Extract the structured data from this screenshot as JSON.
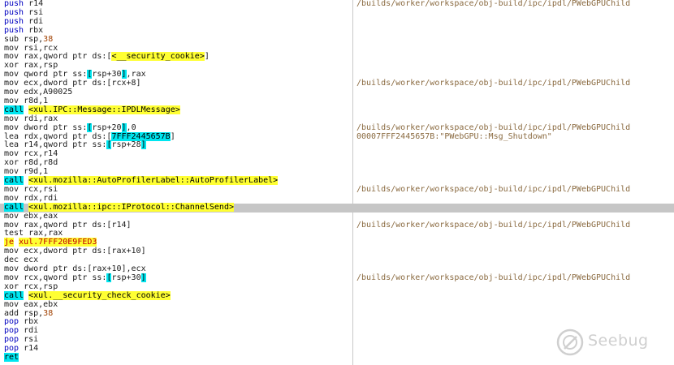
{
  "rows": [
    {
      "mnem": "push",
      "parts": [
        {
          "t": " r14"
        }
      ],
      "comment": "/builds/worker/workspace/obj-build/ipc/ipdl/PWebGPUChild"
    },
    {
      "mnem": "push",
      "parts": [
        {
          "t": " rsi"
        }
      ],
      "comment": ""
    },
    {
      "mnem": "push",
      "parts": [
        {
          "t": " rdi"
        }
      ],
      "comment": ""
    },
    {
      "mnem": "push",
      "parts": [
        {
          "t": " rbx"
        }
      ],
      "comment": ""
    },
    {
      "mnem": "sub",
      "parts": [
        {
          "t": " rsp,"
        },
        {
          "t": "38",
          "c": "num"
        }
      ],
      "comment": ""
    },
    {
      "mnem": "mov",
      "parts": [
        {
          "t": " rsi,rcx"
        }
      ],
      "comment": ""
    },
    {
      "mnem": "mov",
      "parts": [
        {
          "t": " rax,qword ptr ds:["
        },
        {
          "t": "<__security_cookie>",
          "c": "tgt"
        },
        {
          "t": "]"
        }
      ],
      "comment": ""
    },
    {
      "mnem": "xor",
      "parts": [
        {
          "t": " rax,rsp"
        }
      ],
      "comment": ""
    },
    {
      "mnem": "mov",
      "parts": [
        {
          "t": " qword ptr ss:"
        },
        {
          "t": "[",
          "c": "hl"
        },
        {
          "t": "rsp+30"
        },
        {
          "t": "]",
          "c": "hl"
        },
        {
          "t": ",rax"
        }
      ],
      "comment": ""
    },
    {
      "mnem": "mov",
      "parts": [
        {
          "t": " ecx,dword ptr ds:[rcx+8]"
        }
      ],
      "comment": "/builds/worker/workspace/obj-build/ipc/ipdl/PWebGPUChild"
    },
    {
      "mnem": "mov",
      "parts": [
        {
          "t": " edx,A90025"
        }
      ],
      "comment": ""
    },
    {
      "mnem": "mov",
      "parts": [
        {
          "t": " r8d,1"
        }
      ],
      "comment": ""
    },
    {
      "mnem": "call",
      "mc": "mn-call",
      "parts": [
        {
          "t": " "
        },
        {
          "t": "<xul.IPC::Message::IPDLMessage>",
          "c": "tgt"
        }
      ],
      "comment": ""
    },
    {
      "mnem": "mov",
      "parts": [
        {
          "t": " rdi,rax"
        }
      ],
      "comment": ""
    },
    {
      "mnem": "mov",
      "parts": [
        {
          "t": " dword ptr ss:"
        },
        {
          "t": "[",
          "c": "hl"
        },
        {
          "t": "rsp+20"
        },
        {
          "t": "]",
          "c": "hl"
        },
        {
          "t": ",0"
        }
      ],
      "comment": "/builds/worker/workspace/obj-build/ipc/ipdl/PWebGPUChild"
    },
    {
      "mnem": "lea",
      "parts": [
        {
          "t": " rdx,qword ptr ds:["
        },
        {
          "t": "7FFF2445657B",
          "c": "hl"
        },
        {
          "t": "]"
        }
      ],
      "comment": "00007FFF2445657B:\"PWebGPU::Msg_Shutdown\""
    },
    {
      "mnem": "lea",
      "parts": [
        {
          "t": " r14,qword ptr ss:"
        },
        {
          "t": "[",
          "c": "hl"
        },
        {
          "t": "rsp+28"
        },
        {
          "t": "]",
          "c": "hl"
        }
      ],
      "comment": ""
    },
    {
      "mnem": "mov",
      "parts": [
        {
          "t": " rcx,r14"
        }
      ],
      "comment": ""
    },
    {
      "mnem": "xor",
      "parts": [
        {
          "t": " r8d,r8d"
        }
      ],
      "comment": ""
    },
    {
      "mnem": "mov",
      "parts": [
        {
          "t": " r9d,1"
        }
      ],
      "comment": ""
    },
    {
      "mnem": "call",
      "mc": "mn-call",
      "parts": [
        {
          "t": " "
        },
        {
          "t": "<xul.mozilla::AutoProfilerLabel::AutoProfilerLabel>",
          "c": "tgt"
        }
      ],
      "comment": ""
    },
    {
      "mnem": "mov",
      "parts": [
        {
          "t": " rcx,rsi"
        }
      ],
      "comment": "/builds/worker/workspace/obj-build/ipc/ipdl/PWebGPUChild"
    },
    {
      "mnem": "mov",
      "parts": [
        {
          "t": " rdx,rdi"
        }
      ],
      "comment": ""
    },
    {
      "mnem": "call",
      "mc": "mn-call",
      "sel": true,
      "parts": [
        {
          "t": " "
        },
        {
          "t": "<xul.mozilla::ipc::IProtocol::ChannelSend>",
          "c": "tgt"
        }
      ],
      "comment": ""
    },
    {
      "mnem": "mov",
      "parts": [
        {
          "t": " ebx,eax"
        }
      ],
      "comment": ""
    },
    {
      "mnem": "mov",
      "parts": [
        {
          "t": " rax,qword ptr ds:[r14]"
        }
      ],
      "comment": "/builds/worker/workspace/obj-build/ipc/ipdl/PWebGPUChild"
    },
    {
      "mnem": "test",
      "parts": [
        {
          "t": " rax,rax"
        }
      ],
      "comment": ""
    },
    {
      "mnem": "je",
      "mc": "mn-je",
      "parts": [
        {
          "t": " "
        },
        {
          "t": "xul.7FFF20E9FED3",
          "c": "tgt-red"
        }
      ],
      "comment": ""
    },
    {
      "mnem": "mov",
      "parts": [
        {
          "t": " ecx,dword ptr ds:[rax+10]"
        }
      ],
      "comment": ""
    },
    {
      "mnem": "dec",
      "parts": [
        {
          "t": " ecx"
        }
      ],
      "comment": ""
    },
    {
      "mnem": "mov",
      "parts": [
        {
          "t": " dword ptr ds:[rax+10],ecx"
        }
      ],
      "comment": ""
    },
    {
      "mnem": "mov",
      "parts": [
        {
          "t": " rcx,qword ptr ss:"
        },
        {
          "t": "[",
          "c": "hl"
        },
        {
          "t": "rsp+30"
        },
        {
          "t": "]",
          "c": "hl"
        }
      ],
      "comment": "/builds/worker/workspace/obj-build/ipc/ipdl/PWebGPUChild"
    },
    {
      "mnem": "xor",
      "parts": [
        {
          "t": " rcx,rsp"
        }
      ],
      "comment": ""
    },
    {
      "mnem": "call",
      "mc": "mn-call",
      "parts": [
        {
          "t": " "
        },
        {
          "t": "<xul.__security_check_cookie>",
          "c": "tgt"
        }
      ],
      "comment": ""
    },
    {
      "mnem": "mov",
      "parts": [
        {
          "t": " eax,ebx"
        }
      ],
      "comment": ""
    },
    {
      "mnem": "add",
      "parts": [
        {
          "t": " rsp,"
        },
        {
          "t": "38",
          "c": "num"
        }
      ],
      "comment": ""
    },
    {
      "mnem": "pop",
      "parts": [
        {
          "t": " rbx"
        }
      ],
      "comment": ""
    },
    {
      "mnem": "pop",
      "parts": [
        {
          "t": " rdi"
        }
      ],
      "comment": ""
    },
    {
      "mnem": "pop",
      "parts": [
        {
          "t": " rsi"
        }
      ],
      "comment": ""
    },
    {
      "mnem": "pop",
      "parts": [
        {
          "t": " r14"
        }
      ],
      "comment": ""
    },
    {
      "mnem": "ret",
      "mc": "mn-ret",
      "parts": [],
      "comment": ""
    }
  ],
  "watermark": {
    "text": "Seebug",
    "icon": "seebug-logo-icon"
  }
}
